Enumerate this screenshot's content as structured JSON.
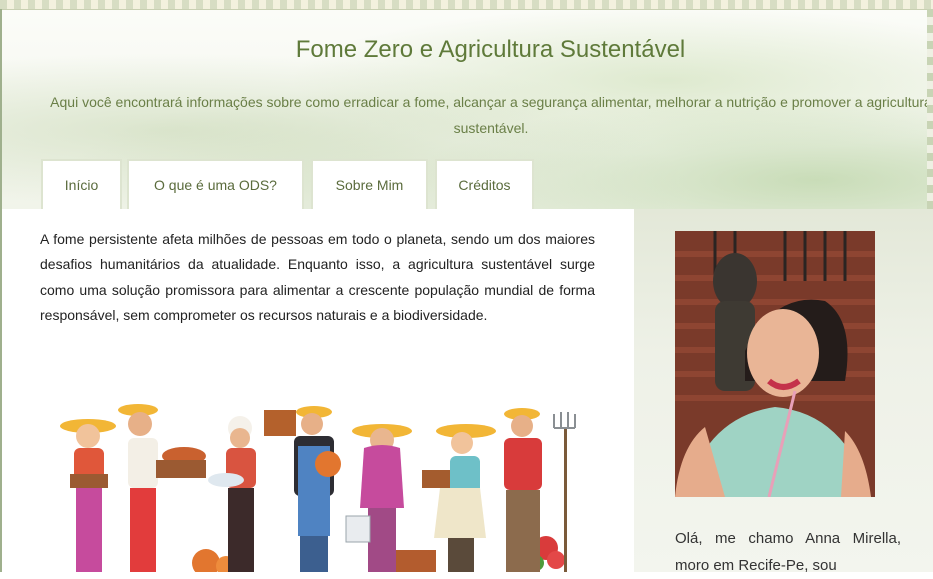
{
  "header": {
    "title": "Fome Zero e Agricultura Sustentável",
    "subtitle": "Aqui você encontrará informações sobre como erradicar a fome, alcançar a segurança alimentar, melhorar a nutrição e promover a agricultura sustentável."
  },
  "nav": {
    "items": [
      {
        "label": "Início"
      },
      {
        "label": "O que é uma ODS?"
      },
      {
        "label": "Sobre Mim"
      },
      {
        "label": "Créditos"
      }
    ]
  },
  "main": {
    "intro": "A fome persistente afeta milhões de pessoas em todo o planeta, sendo um dos maiores desafios humanitários da atualidade. Enquanto isso, a agricultura sustentável surge como uma solução promissora para alimentar a crescente população mundial de forma responsável, sem comprometer os recursos naturais e a biodiversidade."
  },
  "sidebar": {
    "bio": "Olá, me chamo Anna Mirella, moro em Recife-Pe, sou"
  },
  "colors": {
    "title": "#5f7a3a",
    "tab_border": "#dde4d0",
    "sidebar_bg": "#e3e8d8"
  }
}
